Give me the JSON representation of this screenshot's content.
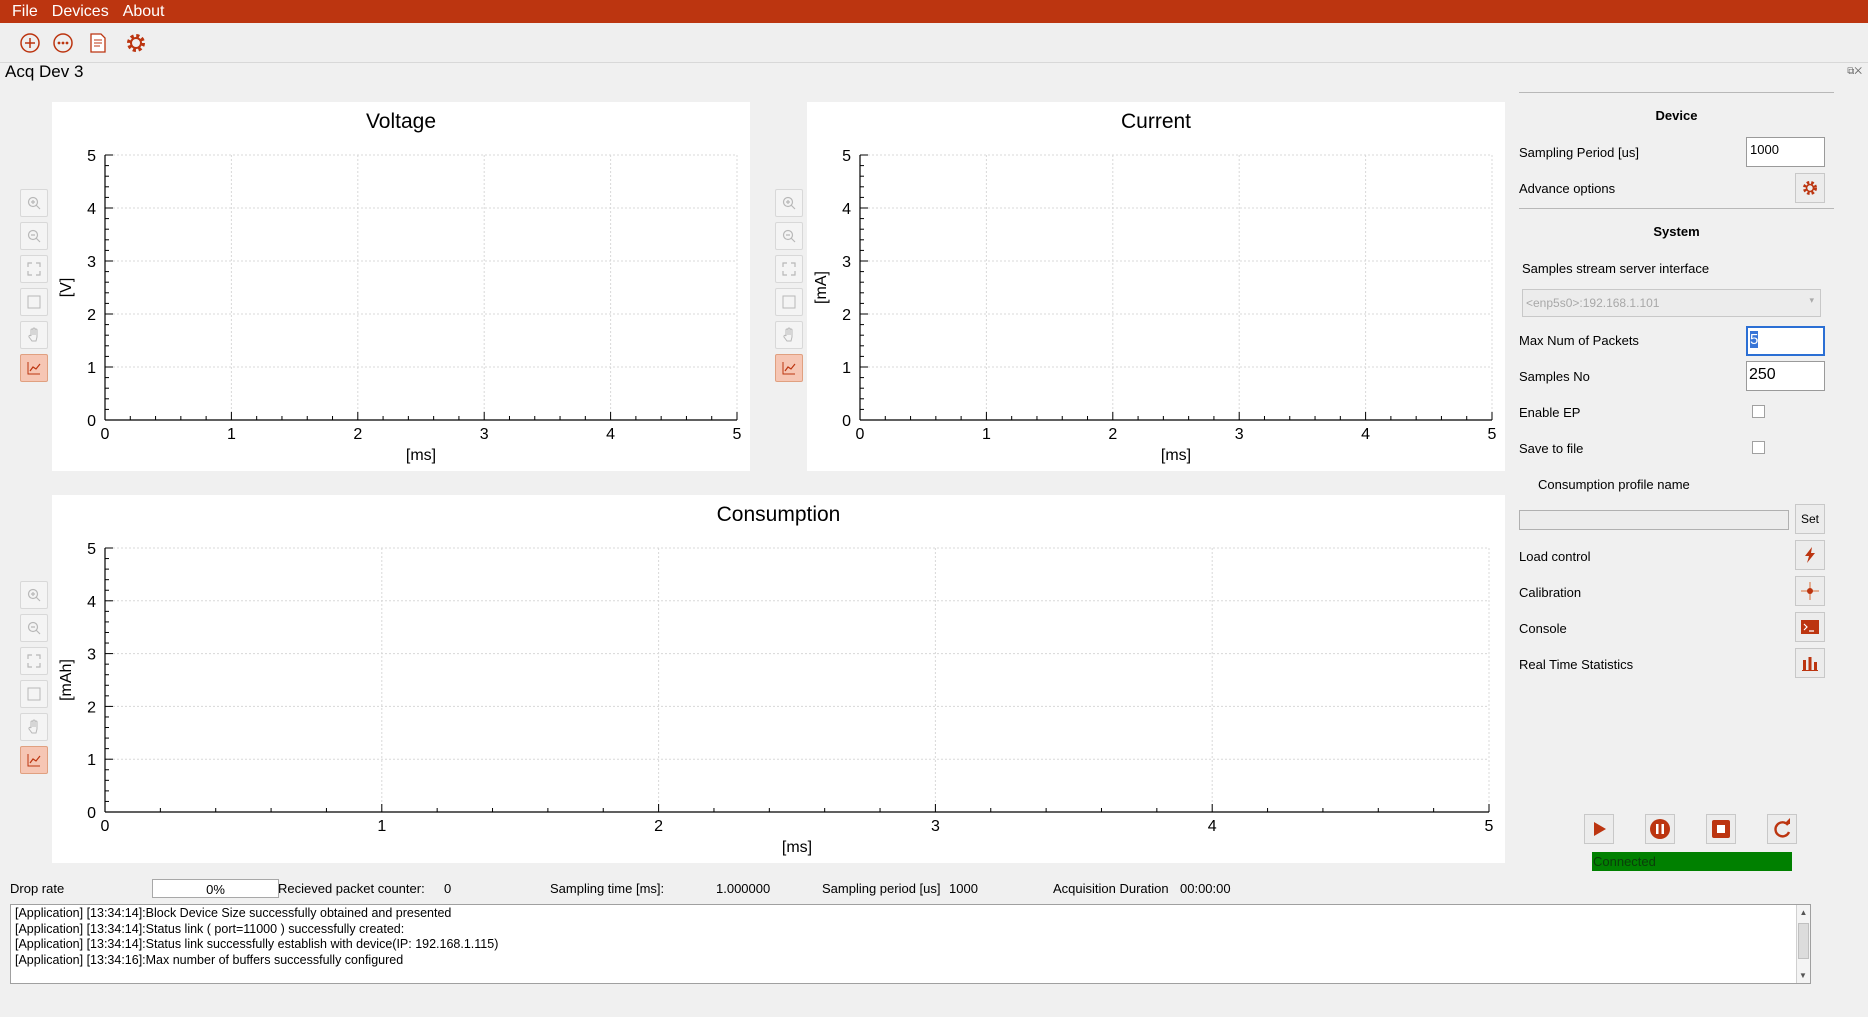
{
  "menu": [
    "File",
    "Devices",
    "About"
  ],
  "toolbar": {
    "icons": [
      "add-icon",
      "more-icon",
      "document-icon",
      "settings-gear-icon"
    ]
  },
  "window_title": "Acq Dev 3",
  "plots": {
    "voltage": {
      "title": "Voltage",
      "xlabel": "[ms]",
      "ylabel": "[V]",
      "xticks": [
        "0",
        "1",
        "2",
        "3",
        "4",
        "5"
      ],
      "yticks": [
        "0",
        "1",
        "2",
        "3",
        "4",
        "5"
      ]
    },
    "current": {
      "title": "Current",
      "xlabel": "[ms]",
      "ylabel": "[mA]",
      "xticks": [
        "0",
        "1",
        "2",
        "3",
        "4",
        "5"
      ],
      "yticks": [
        "0",
        "1",
        "2",
        "3",
        "4",
        "5"
      ]
    },
    "consumption": {
      "title": "Consumption",
      "xlabel": "[ms]",
      "ylabel": "[mAh]",
      "xticks": [
        "0",
        "1",
        "2",
        "3",
        "4",
        "5"
      ],
      "yticks": [
        "0",
        "1",
        "2",
        "3",
        "4",
        "5"
      ]
    }
  },
  "plot_tools": [
    "zoom-in-icon",
    "zoom-out-icon",
    "fit-view-icon",
    "select-area-icon",
    "pan-hand-icon",
    "line-chart-icon"
  ],
  "device": {
    "header": "Device",
    "sampling_period_label": "Sampling Period [us]",
    "sampling_period": "1000",
    "advance_label": "Advance options"
  },
  "system": {
    "header": "System",
    "stream_label": "Samples stream server interface",
    "stream_value": "<enp5s0>:192.168.1.101",
    "max_packets_label": "Max Num of Packets",
    "max_packets": "5",
    "samples_no_label": "Samples No",
    "samples_no": "250",
    "enable_ep_label": "Enable EP",
    "save_file_label": "Save to file",
    "profile_label": "Consumption profile name",
    "profile_value": "",
    "set_label": "Set",
    "load_label": "Load control",
    "calibration_label": "Calibration",
    "console_label": "Console",
    "rts_label": "Real Time Statistics"
  },
  "connection": "Connected",
  "status": {
    "drop_label": "Drop rate",
    "drop_value": "0%",
    "packet_label": "Recieved packet counter:",
    "packet_value": "0",
    "time_label": "Sampling time [ms]:",
    "time_value": "1.000000",
    "period_label": "Sampling period [us]",
    "period_value": "1000",
    "duration_label": "Acquisition Duration",
    "duration_value": "00:00:00"
  },
  "log": [
    "[Application] [13:34:14]:Block Device Size successfully obtained and presented",
    "[Application] [13:34:14]:Status link ( port=11000 ) successfully created:",
    "[Application] [13:34:14]:Status link successfully establish with device(IP: 192.168.1.115)",
    "[Application] [13:34:16]:Max number of buffers successfully configured"
  ],
  "colors": {
    "accent": "#bc3510",
    "connected": "#008000"
  }
}
